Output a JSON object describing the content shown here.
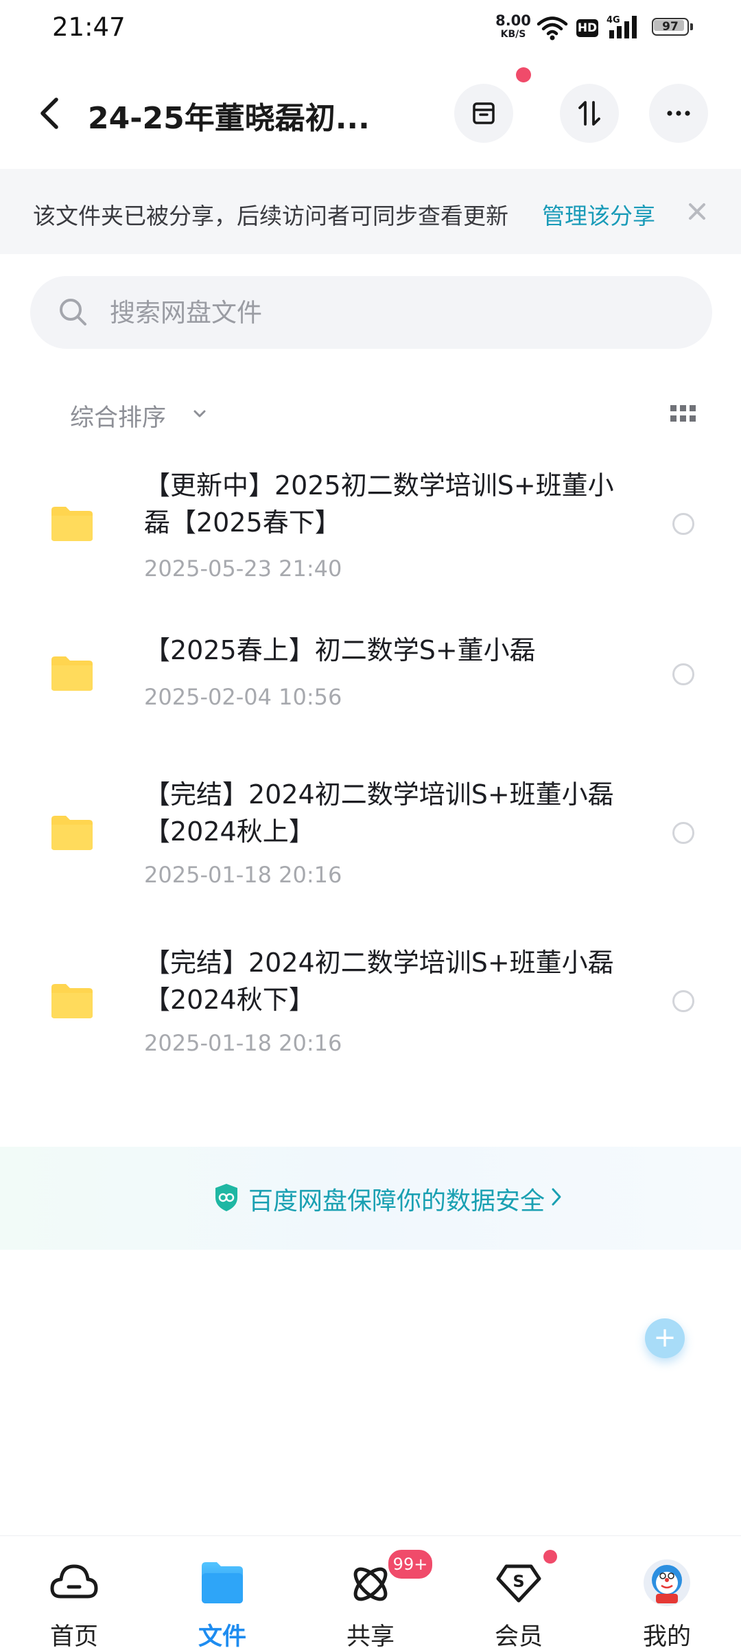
{
  "status_bar": {
    "time": "21:47",
    "net_speed_value": "8.00",
    "net_speed_unit": "KB/S",
    "hd_label": "HD",
    "network_type": "4G",
    "battery_level": "97"
  },
  "header": {
    "title": "24-25年董晓磊初...",
    "back_icon": "back-arrow-icon",
    "actions": [
      "archive-icon",
      "transfer-icon",
      "more-icon"
    ]
  },
  "share_banner": {
    "text": "该文件夹已被分享，后续访问者可同步查看更新",
    "link": "管理该分享"
  },
  "search": {
    "placeholder": "搜索网盘文件"
  },
  "sort": {
    "label": "综合排序"
  },
  "files": [
    {
      "name": "【更新中】2025初二数学培训S+班董小磊【2025春下】",
      "date": "2025-05-23  21:40"
    },
    {
      "name": "【2025春上】初二数学S+董小磊",
      "date": "2025-02-04  10:56"
    },
    {
      "name": "【完结】2024初二数学培训S+班董小磊【2024秋上】",
      "date": "2025-01-18  20:16"
    },
    {
      "name": "【完结】2024初二数学培训S+班董小磊【2024秋下】",
      "date": "2025-01-18  20:16"
    }
  ],
  "security": {
    "text": "百度网盘保障你的数据安全"
  },
  "fab": {
    "label": "+"
  },
  "bottom_nav": {
    "items": [
      {
        "label": "首页",
        "icon": "cloud-home-icon"
      },
      {
        "label": "文件",
        "icon": "folder-tab-icon",
        "active": true
      },
      {
        "label": "共享",
        "icon": "share-orbit-icon",
        "badge": "99+"
      },
      {
        "label": "会员",
        "icon": "vip-s-icon"
      },
      {
        "label": "我的",
        "icon": "avatar"
      }
    ]
  },
  "colors": {
    "accent": "#1e8cf0",
    "link": "#1a9bb8",
    "badge": "#f04b6a",
    "folder": "#ffd54f"
  }
}
